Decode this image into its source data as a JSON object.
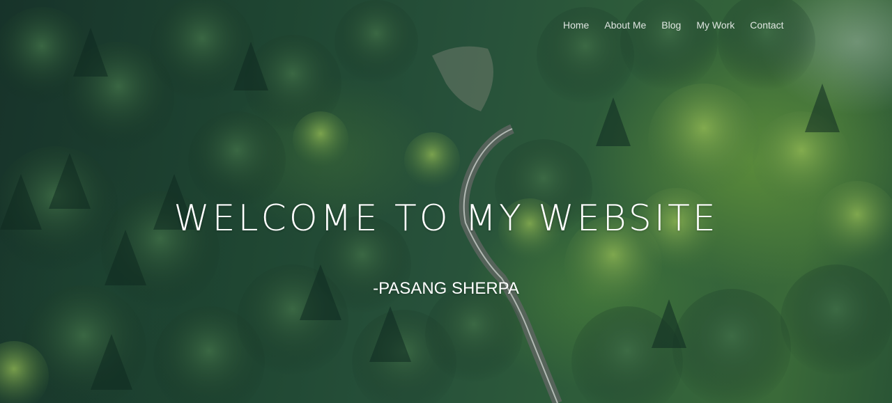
{
  "nav": {
    "items": [
      {
        "label": "Home"
      },
      {
        "label": "About Me"
      },
      {
        "label": "Blog"
      },
      {
        "label": "My Work"
      },
      {
        "label": "Contact"
      }
    ]
  },
  "hero": {
    "title": "WELCOME TO MY WEBSITE",
    "subtitle": "-PASANG SHERPA",
    "background": "aerial-forest-road-photo"
  },
  "colors": {
    "text": "#ffffff",
    "forest_dark": "#17332a",
    "forest_light": "#3a6a39",
    "road": "#8a8f8c"
  }
}
